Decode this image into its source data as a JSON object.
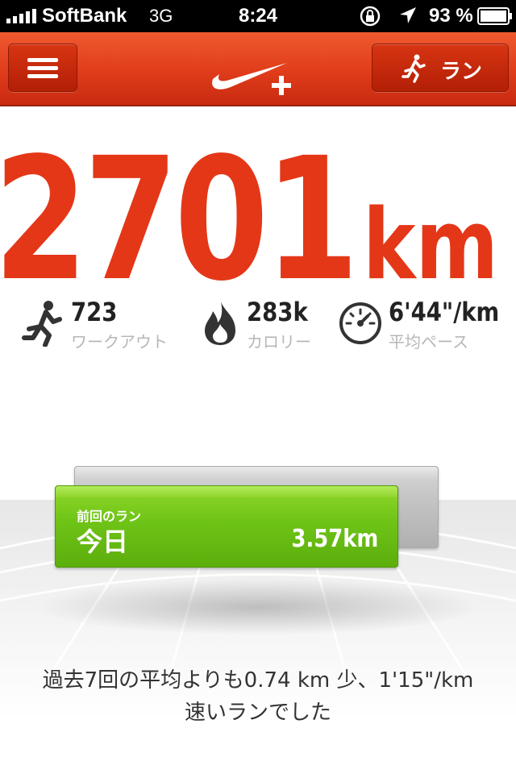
{
  "status_bar": {
    "carrier": "SoftBank",
    "network": "3G",
    "time": "8:24",
    "battery": "93 %",
    "icons": [
      "signal-icon",
      "orientation-lock-icon",
      "location-icon",
      "battery-icon"
    ]
  },
  "nav": {
    "menu_icon": "hamburger-menu-icon",
    "logo": "nike-plus-logo",
    "run_button_label": "ラン",
    "run_icon": "runner-icon"
  },
  "total": {
    "distance": "2701",
    "unit": "km"
  },
  "stats": {
    "workouts": {
      "value": "723",
      "label": "ワークアウト",
      "icon": "runner-icon"
    },
    "calories": {
      "value": "283k",
      "label": "カロリー",
      "icon": "flame-icon"
    },
    "pace": {
      "value": "6'44\"/km",
      "label": "平均ペース",
      "icon": "speedometer-icon"
    }
  },
  "last_run": {
    "caption": "前回のラン",
    "day": "今日",
    "distance": "3.57km"
  },
  "summary": {
    "line1": "過去7回の平均よりも0.74 km 少、1'15\"/km",
    "line2": "速いランでした"
  },
  "colors": {
    "accent_red": "#e43718",
    "nav_red": "#e03c1b",
    "bar_green": "#6ec317",
    "bar_gray": "#c6c6c6"
  }
}
